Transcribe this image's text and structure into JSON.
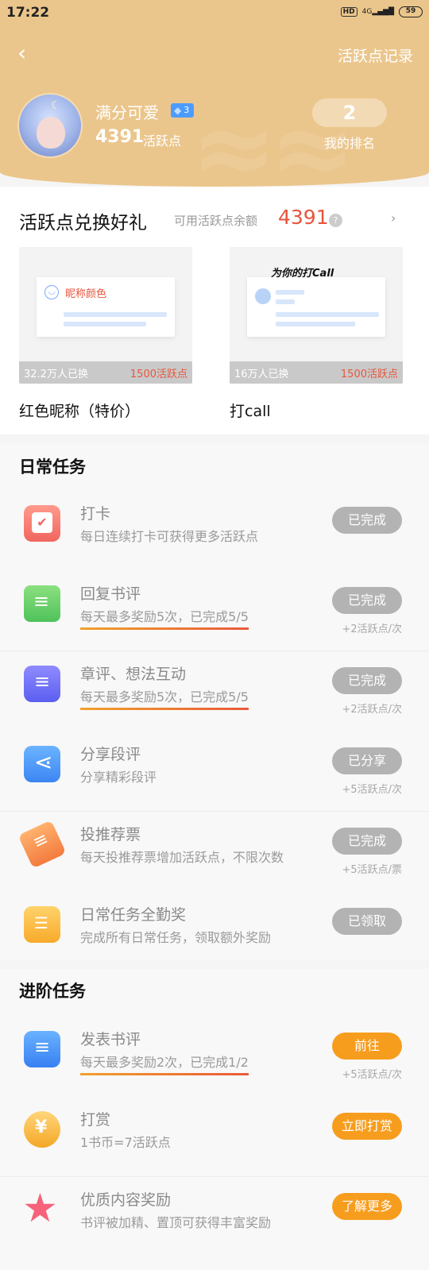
{
  "status_bar": {
    "time": "17:22",
    "hd": "HD",
    "network": "4G",
    "battery": "59"
  },
  "header": {
    "back_icon": "chevron-left-icon",
    "record_link": "活跃点记录",
    "nickname": "满分可爱",
    "level": "3",
    "points": "4391",
    "points_unit": "活跃点",
    "rank": "2",
    "rank_label": "我的排名",
    "colors": {
      "header_bg": "#ebc68c",
      "accent_red": "#e8553c",
      "accent_orange": "#f79d1e"
    }
  },
  "exchange": {
    "title": "活跃点兑换好礼",
    "balance_label": "可用活跃点余额",
    "balance": "4391",
    "help_icon": "?",
    "more_icon": "›",
    "cards": [
      {
        "name": "红色昵称（特价）",
        "count": "32.2万人已换",
        "price": "1500活跃点",
        "preview_text": "昵称颜色"
      },
      {
        "name": "打call",
        "count": "16万人已换",
        "price": "1500活跃点",
        "preview_text": "为你的打Call"
      }
    ]
  },
  "daily": {
    "title": "日常任务",
    "tasks": [
      {
        "name": "打卡",
        "desc": "每日连续打卡可获得更多活跃点",
        "button": "已完成",
        "reward": "",
        "icon": "calendar-icon"
      },
      {
        "name": "回复书评",
        "desc": "每天最多奖励5次，已完成5/5",
        "button": "已完成",
        "reward": "+2活跃点/次",
        "icon": "chat-icon"
      },
      {
        "name": "章评、想法互动",
        "desc": "每天最多奖励5次，已完成5/5",
        "button": "已完成",
        "reward": "+2活跃点/次",
        "icon": "comment-icon"
      },
      {
        "name": "分享段评",
        "desc": "分享精彩段评",
        "button": "已分享",
        "reward": "+5活跃点/次",
        "icon": "share-icon"
      },
      {
        "name": "投推荐票",
        "desc": "每天投推荐票增加活跃点，不限次数",
        "button": "已完成",
        "reward": "+5活跃点/票",
        "icon": "ticket-icon"
      },
      {
        "name": "日常任务全勤奖",
        "desc": "完成所有日常任务，领取额外奖励",
        "button": "已领取",
        "reward": "",
        "icon": "list-icon"
      }
    ]
  },
  "advanced": {
    "title": "进阶任务",
    "tasks": [
      {
        "name": "发表书评",
        "desc": "每天最多奖励2次，已完成1/2",
        "button": "前往",
        "reward": "+5活跃点/次",
        "icon": "post-icon"
      },
      {
        "name": "打赏",
        "desc": "1书币=7活跃点",
        "button": "立即打赏",
        "reward": "",
        "icon": "coin-icon"
      },
      {
        "name": "优质内容奖励",
        "desc": "书评被加精、置顶可获得丰富奖励",
        "button": "了解更多",
        "reward": "",
        "icon": "star-icon"
      }
    ]
  }
}
